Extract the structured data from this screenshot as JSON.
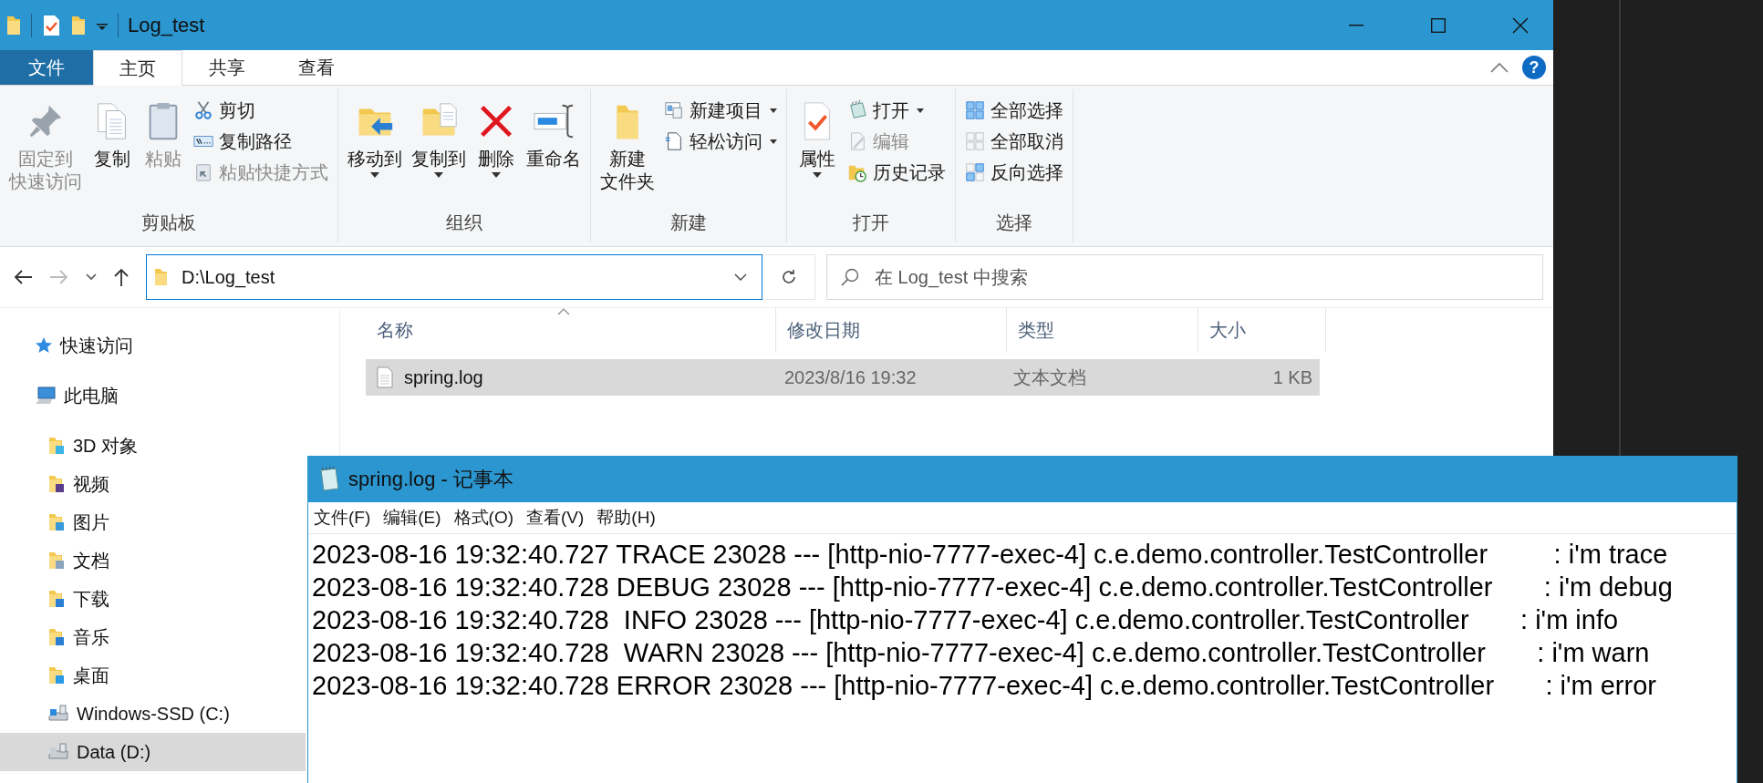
{
  "explorer": {
    "title": "Log_test",
    "ribbon_tabs": [
      {
        "label": "文件",
        "kind": "file",
        "selected": false
      },
      {
        "label": "主页",
        "kind": "tab",
        "selected": true
      },
      {
        "label": "共享",
        "kind": "tab",
        "selected": false
      },
      {
        "label": "查看",
        "kind": "tab",
        "selected": false
      }
    ],
    "help_button": "?",
    "ribbon_groups": [
      {
        "label": "剪贴板",
        "large": [
          {
            "label_lines": [
              "固定到",
              "快速访问"
            ],
            "disabled": true,
            "dropdown": false
          },
          {
            "label_lines": [
              "复制"
            ],
            "disabled": false,
            "dropdown": false
          },
          {
            "label_lines": [
              "粘贴"
            ],
            "disabled": true,
            "dropdown": false
          }
        ],
        "small": [
          {
            "label": "剪切",
            "disabled": false,
            "dropdown": false
          },
          {
            "label": "复制路径",
            "disabled": false,
            "dropdown": false
          },
          {
            "label": "粘贴快捷方式",
            "disabled": true,
            "dropdown": false
          }
        ]
      },
      {
        "label": "组织",
        "large": [
          {
            "label_lines": [
              "移动到"
            ],
            "disabled": false,
            "dropdown": true
          },
          {
            "label_lines": [
              "复制到"
            ],
            "disabled": false,
            "dropdown": true
          },
          {
            "label_lines": [
              "删除"
            ],
            "disabled": false,
            "dropdown": true
          },
          {
            "label_lines": [
              "重命名"
            ],
            "disabled": false,
            "dropdown": false
          }
        ]
      },
      {
        "label": "新建",
        "large": [
          {
            "label_lines": [
              "新建",
              "文件夹"
            ],
            "disabled": false,
            "dropdown": false
          }
        ],
        "small": [
          {
            "label": "新建项目",
            "disabled": false,
            "dropdown": true
          },
          {
            "label": "轻松访问",
            "disabled": false,
            "dropdown": true
          }
        ]
      },
      {
        "label": "打开",
        "large": [
          {
            "label_lines": [
              "属性"
            ],
            "disabled": false,
            "dropdown": true
          }
        ],
        "small": [
          {
            "label": "打开",
            "disabled": false,
            "dropdown": true
          },
          {
            "label": "编辑",
            "disabled": true,
            "dropdown": false
          },
          {
            "label": "历史记录",
            "disabled": false,
            "dropdown": false
          }
        ]
      },
      {
        "label": "选择",
        "small": [
          {
            "label": "全部选择",
            "disabled": false,
            "dropdown": false
          },
          {
            "label": "全部取消",
            "disabled": false,
            "dropdown": false
          },
          {
            "label": "反向选择",
            "disabled": false,
            "dropdown": false
          }
        ]
      }
    ],
    "address": {
      "value": "D:\\Log_test"
    },
    "search": {
      "placeholder": "在 Log_test 中搜索"
    },
    "navigation": [
      {
        "label": "快速访问",
        "selected": false
      },
      {
        "label": "此电脑",
        "selected": false,
        "children": [
          {
            "label": "3D 对象",
            "selected": false
          },
          {
            "label": "视频",
            "selected": false
          },
          {
            "label": "图片",
            "selected": false
          },
          {
            "label": "文档",
            "selected": false
          },
          {
            "label": "下载",
            "selected": false
          },
          {
            "label": "音乐",
            "selected": false
          },
          {
            "label": "桌面",
            "selected": false
          },
          {
            "label": "Windows-SSD (C:)",
            "selected": false
          },
          {
            "label": "Data (D:)",
            "selected": true
          }
        ]
      }
    ],
    "columns": [
      "名称",
      "修改日期",
      "类型",
      "大小"
    ],
    "files": [
      {
        "name": "spring.log",
        "modified": "2023/8/16 19:32",
        "type": "文本文档",
        "size": "1 KB",
        "selected": true
      }
    ]
  },
  "notepad": {
    "title": "spring.log - 记事本",
    "menu": [
      "文件(F)",
      "编辑(E)",
      "格式(O)",
      "查看(V)",
      "帮助(H)"
    ],
    "lines": [
      "2023-08-16 19:32:40.727 TRACE 23028 --- [http-nio-7777-exec-4] c.e.demo.controller.TestController         : i'm trace",
      "2023-08-16 19:32:40.728 DEBUG 23028 --- [http-nio-7777-exec-4] c.e.demo.controller.TestController       : i'm debug",
      "2023-08-16 19:32:40.728  INFO 23028 --- [http-nio-7777-exec-4] c.e.demo.controller.TestController       : i'm info",
      "2023-08-16 19:32:40.728  WARN 23028 --- [http-nio-7777-exec-4] c.e.demo.controller.TestController       : i'm warn",
      "2023-08-16 19:32:40.728 ERROR 23028 --- [http-nio-7777-exec-4] c.e.demo.controller.TestController       : i'm error"
    ]
  }
}
